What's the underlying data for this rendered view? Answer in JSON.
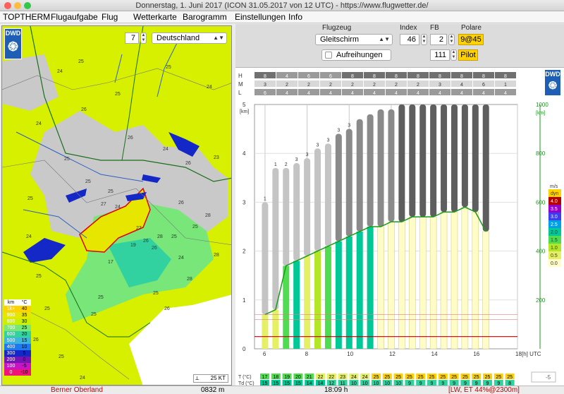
{
  "window": {
    "title": "Donnerstag, 1. Juni 2017 (ICON 31.05.2017 von 12 UTC) - https://www.flugwetter.de/"
  },
  "menu": [
    "TOPTHERM",
    "Flugaufgabe",
    "Flug",
    "Wetterkarte",
    "Barogramm",
    "Einstellungen",
    "Info"
  ],
  "map": {
    "logo": "DWD",
    "zoom_value": "7",
    "region": "Deutschland",
    "scale_label": "25 KT",
    "cell_numbers": [
      {
        "t": "24"
      },
      {
        "t": "25"
      },
      {
        "t": "25"
      },
      {
        "t": "24"
      },
      {
        "t": "26"
      },
      {
        "t": "25"
      },
      {
        "t": "24"
      },
      {
        "t": "26"
      },
      {
        "t": "24"
      },
      {
        "t": "23"
      },
      {
        "t": "26"
      },
      {
        "t": "25"
      },
      {
        "t": "25"
      },
      {
        "t": "25"
      },
      {
        "t": "26"
      },
      {
        "t": "28"
      },
      {
        "t": "25"
      },
      {
        "t": "25"
      },
      {
        "t": "28"
      },
      {
        "t": "27"
      },
      {
        "t": "24"
      },
      {
        "t": "27"
      },
      {
        "t": "25"
      },
      {
        "t": "26"
      },
      {
        "t": "19"
      },
      {
        "t": "17"
      },
      {
        "t": "26"
      },
      {
        "t": "25"
      },
      {
        "t": "26"
      },
      {
        "t": "28"
      },
      {
        "t": "24"
      },
      {
        "t": "25"
      },
      {
        "t": "26"
      },
      {
        "t": "25"
      },
      {
        "t": "24"
      },
      {
        "t": "25"
      },
      {
        "t": "25"
      },
      {
        "t": "28"
      },
      {
        "t": "25"
      },
      {
        "t": "24"
      }
    ],
    "legend": {
      "unit_km": "km",
      "unit_c": "°C",
      "rows": [
        {
          "km": "1k+",
          "c": "40",
          "color": "#ffd200"
        },
        {
          "km": "900",
          "c": "35",
          "color": "#e6e600"
        },
        {
          "km": "800",
          "c": "30",
          "color": "#c8f000"
        },
        {
          "km": "700",
          "c": "25",
          "color": "#78e678"
        },
        {
          "km": "600",
          "c": "20",
          "color": "#32d2a0"
        },
        {
          "km": "500",
          "c": "15",
          "color": "#3cb4dc"
        },
        {
          "km": "400",
          "c": "10",
          "color": "#1e78f0"
        },
        {
          "km": "300",
          "c": "5",
          "color": "#1428c8"
        },
        {
          "km": "200",
          "c": "0",
          "color": "#7814b4"
        },
        {
          "km": "100",
          "c": "-5",
          "color": "#c814c8"
        },
        {
          "km": "0",
          "c": "-10",
          "color": "#f01478"
        }
      ]
    }
  },
  "controls": {
    "flugzeug_label": "Flugzeug",
    "flugzeug_value": "Gleitschirm",
    "index_label": "Index",
    "index_value": "46",
    "fb_label": "FB",
    "fb_value": "2",
    "polare_label": "Polare",
    "polare_value": "9@45",
    "aufreihungen_label": "Aufreihungen",
    "number_value": "111",
    "pilot_label": "Pilot",
    "logo": "DWD"
  },
  "chart_data": {
    "type": "bar",
    "title": "",
    "xlabel": "[h] UTC",
    "ylabel_left": "[km]",
    "ylabel_right": "[km]",
    "ylim_left": [
      0,
      5
    ],
    "ylim_right": [
      0,
      1000
    ],
    "x_ticks": [
      "6",
      "8",
      "10",
      "12",
      "14",
      "16",
      "18"
    ],
    "y_ticks_left": [
      "0",
      "1",
      "2",
      "3",
      "4",
      "5"
    ],
    "y_ticks_right": [
      "200",
      "400",
      "600",
      "800",
      "1000"
    ],
    "cloud_rows": {
      "H": [
        "8",
        "4",
        "6",
        "6",
        "8",
        "8",
        "8",
        "8",
        "8",
        "8",
        "8",
        "8"
      ],
      "M": [
        "3",
        "2",
        "2",
        "2",
        "2",
        "2",
        "2",
        "2",
        "3",
        "4",
        "6",
        "1"
      ],
      "L": [
        "6",
        "4",
        "4",
        "4",
        "4",
        "4",
        "4",
        "4",
        "4",
        "4",
        "4",
        "4"
      ]
    },
    "hours": [
      6,
      6.5,
      7,
      7.5,
      8,
      8.5,
      9,
      9.5,
      10,
      10.5,
      11,
      11.5,
      12,
      12.5,
      13,
      13.5,
      14,
      14.5,
      15,
      15.5,
      16,
      16.5
    ],
    "cloud_top_km": [
      3.0,
      3.7,
      3.7,
      3.8,
      3.9,
      4.1,
      4.2,
      4.4,
      4.5,
      4.7,
      4.8,
      4.9,
      4.9,
      5.0,
      5.0,
      5.0,
      5.0,
      5.0,
      5.0,
      5.0,
      5.0,
      5.0
    ],
    "thermal_top_km": [
      0.7,
      0.8,
      1.7,
      1.8,
      1.9,
      2.0,
      2.1,
      2.2,
      2.3,
      2.4,
      2.5,
      2.5,
      2.6,
      2.6,
      2.7,
      2.7,
      2.7,
      2.8,
      2.8,
      2.9,
      2.8,
      2.4
    ],
    "cloud_base_labels": [
      "1",
      "1",
      "2",
      "3",
      "3",
      "3",
      "3",
      "3",
      "3"
    ],
    "temp_row_label": "T (°C)",
    "td_row_label": "Td (°C)",
    "temps": [
      "17",
      "18",
      "19",
      "20",
      "21",
      "22",
      "22",
      "23",
      "24",
      "24",
      "25",
      "25",
      "25",
      "25",
      "25",
      "25",
      "25",
      "25",
      "25",
      "25",
      "25",
      "25",
      "25"
    ],
    "dewpoints": [
      "15",
      "15",
      "15",
      "15",
      "14",
      "14",
      "12",
      "11",
      "10",
      "10",
      "10",
      "10",
      "10",
      "9",
      "9",
      "9",
      "9",
      "9",
      "9",
      "9",
      "9",
      "9",
      "8"
    ],
    "climb_legend": {
      "unit": "m/s",
      "rows": [
        {
          "v": "dyn",
          "color": "#ffd200"
        },
        {
          "v": "4.0",
          "color": "#b40000"
        },
        {
          "v": "3.5",
          "color": "#9600c8"
        },
        {
          "v": "3.0",
          "color": "#3c3cf0"
        },
        {
          "v": "2.5",
          "color": "#00a0e6"
        },
        {
          "v": "2.0",
          "color": "#00c896"
        },
        {
          "v": "1.5",
          "color": "#50dc50"
        },
        {
          "v": "1.0",
          "color": "#b4e628"
        },
        {
          "v": "0.5",
          "color": "#e6f064"
        },
        {
          "v": "0.0",
          "color": "#fffcc8"
        }
      ]
    },
    "neg_value": "-5"
  },
  "status": {
    "region": "Berner Oberland",
    "altitude": "0832 m",
    "time": "18:09 h",
    "info": "[LW, ET  44%@2300m]"
  }
}
